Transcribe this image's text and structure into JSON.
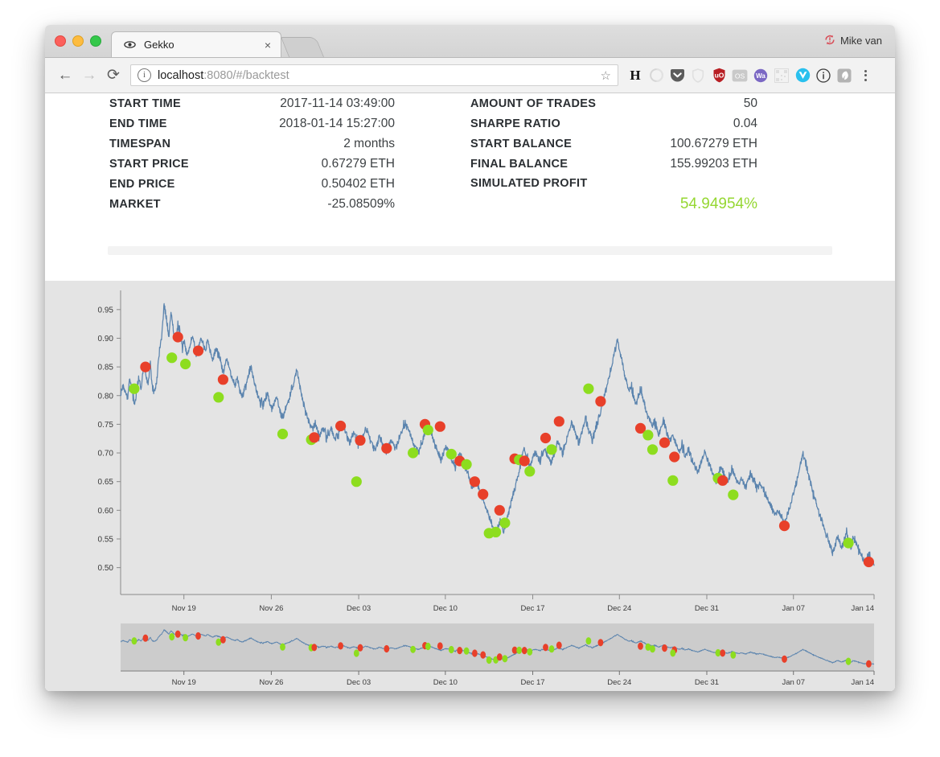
{
  "window": {
    "traffic_lights": [
      "close",
      "minimize",
      "maximize"
    ],
    "profile_name": "Mike van",
    "profile_icon": "sync-error-icon"
  },
  "tab": {
    "title": "Gekko",
    "favicon": "eye-icon",
    "close_label": "×",
    "new_tab_label": ""
  },
  "toolbar": {
    "back_label": "←",
    "forward_label": "→",
    "reload_label": "⟳",
    "site_info_label": "i",
    "bookmark_label": "☆",
    "menu_label": "⋮",
    "extensions": [
      {
        "name": "hypothesis-extension-icon",
        "glyph": "H"
      },
      {
        "name": "momentum-extension-icon",
        "glyph": "◔"
      },
      {
        "name": "pocket-extension-icon",
        "glyph": "▼"
      },
      {
        "name": "shield-extension-icon",
        "glyph": "⬟"
      },
      {
        "name": "ublock-origin-extension-icon",
        "glyph": "uO"
      },
      {
        "name": "opensource-extension-icon",
        "glyph": "OS"
      },
      {
        "name": "wappalyzer-extension-icon",
        "glyph": "Wa"
      },
      {
        "name": "qrcode-extension-icon",
        "glyph": "░"
      },
      {
        "name": "vue-devtools-extension-icon",
        "glyph": "V"
      },
      {
        "name": "info-extension-icon",
        "glyph": "ⓘ"
      },
      {
        "name": "evernote-extension-icon",
        "glyph": "◗"
      }
    ]
  },
  "url": {
    "host": "localhost",
    "path": ":8080/#/backtest",
    "full": "localhost:8080/#/backtest"
  },
  "stats": {
    "left": [
      {
        "label": "START TIME",
        "value": "2017-11-14 03:49:00"
      },
      {
        "label": "END TIME",
        "value": "2018-01-14 15:27:00"
      },
      {
        "label": "TIMESPAN",
        "value": "2 months"
      },
      {
        "label": "START PRICE",
        "value": "0.67279 ETH"
      },
      {
        "label": "END PRICE",
        "value": "0.50402 ETH"
      },
      {
        "label": "MARKET",
        "value": "-25.08509%"
      }
    ],
    "right": [
      {
        "label": "AMOUNT OF TRADES",
        "value": "50"
      },
      {
        "label": "SHARPE RATIO",
        "value": "0.04"
      },
      {
        "label": "START BALANCE",
        "value": "100.67279 ETH"
      },
      {
        "label": "FINAL BALANCE",
        "value": "155.99203 ETH"
      },
      {
        "label": "SIMULATED PROFIT",
        "value": ""
      }
    ],
    "simulated_profit": "54.94954%",
    "profit_color": "#95d732"
  },
  "chart_data": {
    "type": "line",
    "title": "",
    "xlabel": "",
    "ylabel": "",
    "ylim": [
      0.47,
      0.975
    ],
    "yticks": [
      0.5,
      0.55,
      0.6,
      0.65,
      0.7,
      0.75,
      0.8,
      0.85,
      0.9,
      0.95
    ],
    "ytick_labels": [
      "0.50",
      "0.55",
      "0.60",
      "0.65",
      "0.70",
      "0.75",
      "0.80",
      "0.85",
      "0.90",
      "0.95"
    ],
    "xticks": [
      "Nov 19",
      "Nov 26",
      "Dec 03",
      "Dec 10",
      "Dec 17",
      "Dec 24",
      "Dec 31",
      "Jan 07",
      "Jan 14"
    ],
    "xtick_positions": [
      0.084,
      0.2,
      0.316,
      0.431,
      0.547,
      0.662,
      0.778,
      0.893,
      1.0
    ],
    "grid": false,
    "line_color": "#5b84ae",
    "plot_background": "#e4e4e4",
    "series": [
      {
        "name": "price",
        "unit": "ETH",
        "values": [
          0.8,
          0.818,
          0.805,
          0.795,
          0.83,
          0.812,
          0.786,
          0.806,
          0.828,
          0.81,
          0.85,
          0.838,
          0.82,
          0.856,
          0.813,
          0.808,
          0.835,
          0.88,
          0.905,
          0.96,
          0.932,
          0.9,
          0.945,
          0.915,
          0.892,
          0.922,
          0.906,
          0.884,
          0.893,
          0.87,
          0.882,
          0.902,
          0.895,
          0.872,
          0.886,
          0.9,
          0.89,
          0.876,
          0.897,
          0.88,
          0.862,
          0.874,
          0.883,
          0.87,
          0.852,
          0.841,
          0.866,
          0.855,
          0.838,
          0.826,
          0.818,
          0.832,
          0.81,
          0.798,
          0.808,
          0.822,
          0.838,
          0.852,
          0.83,
          0.812,
          0.8,
          0.79,
          0.782,
          0.794,
          0.806,
          0.788,
          0.776,
          0.786,
          0.8,
          0.784,
          0.77,
          0.762,
          0.775,
          0.788,
          0.8,
          0.812,
          0.828,
          0.846,
          0.82,
          0.8,
          0.784,
          0.768,
          0.756,
          0.748,
          0.74,
          0.752,
          0.738,
          0.728,
          0.742,
          0.736,
          0.726,
          0.734,
          0.742,
          0.73,
          0.722,
          0.734,
          0.744,
          0.752,
          0.738,
          0.726,
          0.718,
          0.728,
          0.736,
          0.724,
          0.714,
          0.722,
          0.73,
          0.742,
          0.736,
          0.722,
          0.712,
          0.704,
          0.716,
          0.728,
          0.72,
          0.71,
          0.7,
          0.712,
          0.722,
          0.715,
          0.706,
          0.718,
          0.73,
          0.74,
          0.752,
          0.748,
          0.738,
          0.726,
          0.716,
          0.708,
          0.7,
          0.712,
          0.724,
          0.736,
          0.748,
          0.742,
          0.73,
          0.718,
          0.706,
          0.696,
          0.688,
          0.7,
          0.712,
          0.704,
          0.694,
          0.686,
          0.678,
          0.69,
          0.7,
          0.692,
          0.682,
          0.67,
          0.66,
          0.65,
          0.64,
          0.652,
          0.644,
          0.632,
          0.62,
          0.612,
          0.6,
          0.588,
          0.576,
          0.566,
          0.558,
          0.57,
          0.582,
          0.56,
          0.572,
          0.59,
          0.604,
          0.62,
          0.636,
          0.65,
          0.668,
          0.69,
          0.71,
          0.7,
          0.688,
          0.678,
          0.69,
          0.702,
          0.694,
          0.686,
          0.698,
          0.708,
          0.7,
          0.69,
          0.682,
          0.694,
          0.706,
          0.718,
          0.71,
          0.7,
          0.712,
          0.726,
          0.74,
          0.752,
          0.744,
          0.73,
          0.718,
          0.73,
          0.746,
          0.76,
          0.748,
          0.735,
          0.722,
          0.736,
          0.75,
          0.764,
          0.78,
          0.796,
          0.812,
          0.828,
          0.845,
          0.862,
          0.88,
          0.898,
          0.876,
          0.858,
          0.84,
          0.822,
          0.806,
          0.818,
          0.8,
          0.786,
          0.798,
          0.812,
          0.796,
          0.78,
          0.768,
          0.756,
          0.746,
          0.758,
          0.744,
          0.732,
          0.744,
          0.756,
          0.742,
          0.73,
          0.72,
          0.732,
          0.722,
          0.712,
          0.702,
          0.714,
          0.704,
          0.694,
          0.706,
          0.696,
          0.686,
          0.676,
          0.666,
          0.678,
          0.69,
          0.702,
          0.692,
          0.68,
          0.67,
          0.66,
          0.652,
          0.664,
          0.676,
          0.666,
          0.656,
          0.648,
          0.66,
          0.672,
          0.662,
          0.652,
          0.644,
          0.656,
          0.648,
          0.64,
          0.652,
          0.664,
          0.654,
          0.646,
          0.638,
          0.648,
          0.64,
          0.632,
          0.624,
          0.614,
          0.606,
          0.598,
          0.59,
          0.602,
          0.594,
          0.586,
          0.578,
          0.59,
          0.602,
          0.616,
          0.63,
          0.646,
          0.664,
          0.682,
          0.7,
          0.684,
          0.666,
          0.65,
          0.636,
          0.622,
          0.608,
          0.596,
          0.584,
          0.572,
          0.56,
          0.548,
          0.536,
          0.526,
          0.54,
          0.556,
          0.546,
          0.534,
          0.548,
          0.56,
          0.548,
          0.538,
          0.552,
          0.544,
          0.534,
          0.524,
          0.516,
          0.508,
          0.516,
          0.524,
          0.512,
          0.504
        ]
      }
    ],
    "trades": {
      "buy_color": "#8ddd1f",
      "sell_color": "#e8402a",
      "buy_label": "buy",
      "sell_label": "sell",
      "points": [
        {
          "type": "buy",
          "x": 0.018,
          "y": 0.812
        },
        {
          "type": "sell",
          "x": 0.033,
          "y": 0.85
        },
        {
          "type": "buy",
          "x": 0.068,
          "y": 0.866
        },
        {
          "type": "sell",
          "x": 0.076,
          "y": 0.902
        },
        {
          "type": "buy",
          "x": 0.086,
          "y": 0.855
        },
        {
          "type": "sell",
          "x": 0.103,
          "y": 0.878
        },
        {
          "type": "buy",
          "x": 0.13,
          "y": 0.797
        },
        {
          "type": "sell",
          "x": 0.136,
          "y": 0.828
        },
        {
          "type": "buy",
          "x": 0.215,
          "y": 0.733
        },
        {
          "type": "buy",
          "x": 0.253,
          "y": 0.723
        },
        {
          "type": "sell",
          "x": 0.257,
          "y": 0.727
        },
        {
          "type": "sell",
          "x": 0.292,
          "y": 0.747
        },
        {
          "type": "buy",
          "x": 0.313,
          "y": 0.65
        },
        {
          "type": "sell",
          "x": 0.318,
          "y": 0.722
        },
        {
          "type": "sell",
          "x": 0.353,
          "y": 0.708
        },
        {
          "type": "buy",
          "x": 0.388,
          "y": 0.7
        },
        {
          "type": "sell",
          "x": 0.404,
          "y": 0.75
        },
        {
          "type": "buy",
          "x": 0.408,
          "y": 0.74
        },
        {
          "type": "sell",
          "x": 0.424,
          "y": 0.746
        },
        {
          "type": "buy",
          "x": 0.439,
          "y": 0.698
        },
        {
          "type": "sell",
          "x": 0.45,
          "y": 0.686
        },
        {
          "type": "buy",
          "x": 0.459,
          "y": 0.68
        },
        {
          "type": "sell",
          "x": 0.47,
          "y": 0.65
        },
        {
          "type": "sell",
          "x": 0.481,
          "y": 0.628
        },
        {
          "type": "buy",
          "x": 0.489,
          "y": 0.56
        },
        {
          "type": "buy",
          "x": 0.498,
          "y": 0.562
        },
        {
          "type": "sell",
          "x": 0.503,
          "y": 0.6
        },
        {
          "type": "buy",
          "x": 0.51,
          "y": 0.578
        },
        {
          "type": "sell",
          "x": 0.523,
          "y": 0.69
        },
        {
          "type": "buy",
          "x": 0.529,
          "y": 0.688
        },
        {
          "type": "sell",
          "x": 0.536,
          "y": 0.686
        },
        {
          "type": "buy",
          "x": 0.543,
          "y": 0.668
        },
        {
          "type": "sell",
          "x": 0.564,
          "y": 0.726
        },
        {
          "type": "buy",
          "x": 0.572,
          "y": 0.706
        },
        {
          "type": "sell",
          "x": 0.582,
          "y": 0.755
        },
        {
          "type": "buy",
          "x": 0.621,
          "y": 0.812
        },
        {
          "type": "sell",
          "x": 0.637,
          "y": 0.79
        },
        {
          "type": "sell",
          "x": 0.69,
          "y": 0.743
        },
        {
          "type": "buy",
          "x": 0.7,
          "y": 0.731
        },
        {
          "type": "buy",
          "x": 0.706,
          "y": 0.706
        },
        {
          "type": "sell",
          "x": 0.722,
          "y": 0.718
        },
        {
          "type": "sell",
          "x": 0.735,
          "y": 0.693
        },
        {
          "type": "buy",
          "x": 0.733,
          "y": 0.652
        },
        {
          "type": "buy",
          "x": 0.793,
          "y": 0.656
        },
        {
          "type": "sell",
          "x": 0.799,
          "y": 0.652
        },
        {
          "type": "buy",
          "x": 0.813,
          "y": 0.627
        },
        {
          "type": "sell",
          "x": 0.881,
          "y": 0.573
        },
        {
          "type": "buy",
          "x": 0.966,
          "y": 0.543
        },
        {
          "type": "sell",
          "x": 0.993,
          "y": 0.51
        }
      ]
    },
    "navigator": {
      "selected": true,
      "selection_color": "#cccccc",
      "track_color": "#e0e0e0",
      "xticks": [
        "Nov 19",
        "Nov 26",
        "Dec 03",
        "Dec 10",
        "Dec 17",
        "Dec 24",
        "Dec 31",
        "Jan 07",
        "Jan 14"
      ]
    }
  }
}
